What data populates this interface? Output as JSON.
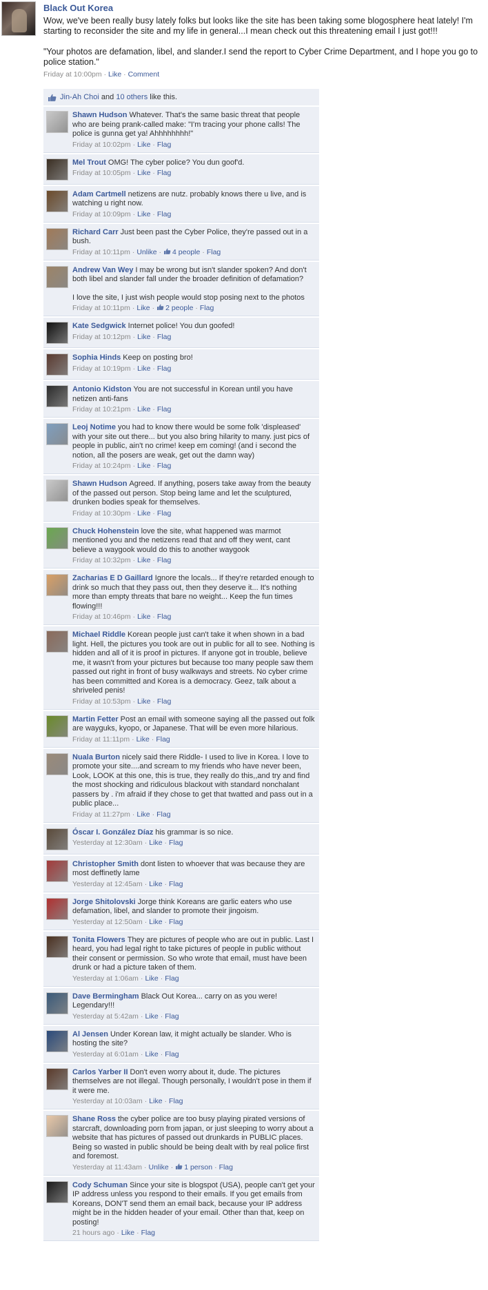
{
  "post": {
    "author": "Black Out Korea",
    "paragraphs": [
      "Wow, we've been really busy lately folks but looks like the site has been taking some blogosphere heat lately! I'm starting to reconsider the site and my life in general...I mean check out this threatening email I just got!!!",
      "\"Your photos are defamation, libel, and slander.I send the report to Cyber Crime Department, and I hope you go to police station.\""
    ],
    "timestamp": "Friday at 10:00pm",
    "like_label": "Like",
    "comment_label": "Comment"
  },
  "likes": {
    "first_liker": "Jin-Ah Choi",
    "joiner": "and",
    "others_link": "10 others",
    "suffix": "like this."
  },
  "comments": [
    {
      "name": "Shawn Hudson",
      "paragraphs": [
        "Whatever. That's the same basic threat that people who are being prank-called make: \"I'm tracing your phone calls! The police is gunna get ya! Ahhhhhhhh!\""
      ],
      "time": "Friday at 10:02pm",
      "actions": [
        "Like",
        "Flag"
      ],
      "avatar_color": "#c9c9c9"
    },
    {
      "name": "Mel Trout",
      "paragraphs": [
        "OMG! The cyber police? You dun goof'd."
      ],
      "time": "Friday at 10:05pm",
      "actions": [
        "Like",
        "Flag"
      ],
      "avatar_color": "#3a2e22"
    },
    {
      "name": "Adam Cartmell",
      "paragraphs": [
        "netizens are nutz. probably knows there u live, and is watching u right now."
      ],
      "time": "Friday at 10:09pm",
      "actions": [
        "Like",
        "Flag"
      ],
      "avatar_color": "#6b4a2a"
    },
    {
      "name": "Richard Carr",
      "paragraphs": [
        "Just been past the Cyber Police, they're passed out in a bush."
      ],
      "time": "Friday at 10:11pm",
      "actions": [
        "Unlike",
        "4 people",
        "Flag"
      ],
      "avatar_color": "#a07a58"
    },
    {
      "name": "Andrew Van Wey",
      "paragraphs": [
        "I may be wrong but isn't slander spoken? And don't both libel and slander fall under the broader definition of defamation?",
        "I love the site, I just wish people would stop posing next to the photos"
      ],
      "time": "Friday at 10:11pm",
      "actions": [
        "Like",
        "2 people",
        "Flag"
      ],
      "avatar_color": "#9c8468"
    },
    {
      "name": "Kate Sedgwick",
      "paragraphs": [
        "Internet police! You dun goofed!"
      ],
      "time": "Friday at 10:12pm",
      "actions": [
        "Like",
        "Flag"
      ],
      "avatar_color": "#111111"
    },
    {
      "name": "Sophia Hinds",
      "paragraphs": [
        "Keep on posting bro!"
      ],
      "time": "Friday at 10:19pm",
      "actions": [
        "Like",
        "Flag"
      ],
      "avatar_color": "#5a3a30"
    },
    {
      "name": "Antonio Kidston",
      "paragraphs": [
        "You are not successful in Korean until you have netizen anti-fans"
      ],
      "time": "Friday at 10:21pm",
      "actions": [
        "Like",
        "Flag"
      ],
      "avatar_color": "#2b2b2b"
    },
    {
      "name": "Leoj Notime",
      "paragraphs": [
        "you had to know there would be some folk 'displeased' with your site out there... but you also bring hilarity to many. just pics of people in public, ain't no crime! keep em coming! (and i second the notion, all the posers are weak, get out the damn way)"
      ],
      "time": "Friday at 10:24pm",
      "actions": [
        "Like",
        "Flag"
      ],
      "avatar_color": "#7f9fbf"
    },
    {
      "name": "Shawn Hudson",
      "paragraphs": [
        "Agreed. If anything, posers take away from the beauty of the passed out person. Stop being lame and let the sculptured, drunken bodies speak for themselves."
      ],
      "time": "Friday at 10:30pm",
      "actions": [
        "Like",
        "Flag"
      ],
      "avatar_color": "#c9c9c9"
    },
    {
      "name": "Chuck Hohenstein",
      "paragraphs": [
        "love the site, what happened was marmot mentioned you and the netizens read that and off they went, cant believe a waygook would do this to another waygook"
      ],
      "time": "Friday at 10:32pm",
      "actions": [
        "Like",
        "Flag"
      ],
      "avatar_color": "#6aa84f"
    },
    {
      "name": "Zacharias E D Gaillard",
      "paragraphs": [
        "Ignore the locals... If they're retarded enough to drink so much that they pass out, then they deserve it... It's nothing more than empty threats that bare no weight... Keep the fun times flowing!!!"
      ],
      "time": "Friday at 10:46pm",
      "actions": [
        "Like",
        "Flag"
      ],
      "avatar_color": "#d9a066"
    },
    {
      "name": "Michael Riddle",
      "paragraphs": [
        "Korean people just can't take it when shown in a bad light. Hell, the pictures you took are out in public for all to see. Nothing is hidden and all of it is proof in pictures. If anyone got in trouble, believe me, it wasn't from your pictures but because too many people saw them passed out right in front of busy walkways and streets. No cyber crime has been committed and Korea is a democracy. Geez, talk about a shriveled penis!"
      ],
      "time": "Friday at 10:53pm",
      "actions": [
        "Like",
        "Flag"
      ],
      "avatar_color": "#8a6a5a"
    },
    {
      "name": "Martin Fetter",
      "paragraphs": [
        "Post an email with someone saying all the passed out folk are wayguks, kyopo, or Japanese. That will be even more hilarious."
      ],
      "time": "Friday at 11:11pm",
      "actions": [
        "Like",
        "Flag"
      ],
      "avatar_color": "#6a8a2a"
    },
    {
      "name": "Nuala Burton",
      "paragraphs": [
        "nicely said there Riddle- I used to live in Korea. I love to promote your site....and scream to my friends who have never been, Look, LOOK at this one, this is true, they really do this,,and try and find the most shocking and ridiculous blackout with standard nonchalant passers by . i'm afraid if they chose to get that twatted and pass out in a public place..."
      ],
      "time": "Friday at 11:27pm",
      "actions": [
        "Like",
        "Flag"
      ],
      "avatar_color": "#9a8a7a"
    },
    {
      "name": "Óscar I. González Díaz",
      "paragraphs": [
        "his grammar is so nice."
      ],
      "time": "Yesterday at 12:30am",
      "actions": [
        "Like",
        "Flag"
      ],
      "avatar_color": "#5a4a3a"
    },
    {
      "name": "Christopher Smith",
      "paragraphs": [
        "dont listen to whoever that was because they are most deffinetly lame"
      ],
      "time": "Yesterday at 12:45am",
      "actions": [
        "Like",
        "Flag"
      ],
      "avatar_color": "#a33a3a"
    },
    {
      "name": "Jorge Shitolovski",
      "paragraphs": [
        "Jorge think Koreans are garlic eaters who use defamation, libel, and slander to promote their jingoism."
      ],
      "time": "Yesterday at 12:50am",
      "actions": [
        "Like",
        "Flag"
      ],
      "avatar_color": "#b03030"
    },
    {
      "name": "Tonita Flowers",
      "paragraphs": [
        "They are pictures of people who are out in public. Last I heard, you had legal right to take pictures of people in public without their consent or permission. So who wrote that email, must have been drunk or had a picture taken of them."
      ],
      "time": "Yesterday at 1:06am",
      "actions": [
        "Like",
        "Flag"
      ],
      "avatar_color": "#4a3020"
    },
    {
      "name": "Dave Bermingham",
      "paragraphs": [
        "Black Out Korea... carry on as you were! Legendary!!!"
      ],
      "time": "Yesterday at 5:42am",
      "actions": [
        "Like",
        "Flag"
      ],
      "avatar_color": "#3a5a7a"
    },
    {
      "name": "Al Jensen",
      "paragraphs": [
        "Under Korean law, it might actually be slander. Who is hosting the site?"
      ],
      "time": "Yesterday at 6:01am",
      "actions": [
        "Like",
        "Flag"
      ],
      "avatar_color": "#2a4a7a"
    },
    {
      "name": "Carlos Yarber II",
      "paragraphs": [
        "Don't even worry about it, dude. The pictures themselves are not illegal. Though personally, I wouldn't pose in them if it were me."
      ],
      "time": "Yesterday at 10:03am",
      "actions": [
        "Like",
        "Flag"
      ],
      "avatar_color": "#5a3a2a"
    },
    {
      "name": "Shane Ross",
      "paragraphs": [
        "the cyber police are too busy playing pirated versions of starcraft, downloading porn from japan, or just sleeping to worry about a website that has pictures of passed out drunkards in PUBLIC places. Being so wasted in public should be being dealt with by real police first and foremost."
      ],
      "time": "Yesterday at 11:43am",
      "actions": [
        "Unlike",
        "1 person",
        "Flag"
      ],
      "avatar_color": "#e8c8a8"
    },
    {
      "name": "Cody Schuman",
      "paragraphs": [
        "Since your site is blogspot (USA), people can't get your IP address unless you respond to their emails. If you get emails from Koreans, DON'T send them an email back, because your IP address might be in the hidden header of your email. Other than that, keep on posting!"
      ],
      "time": "21 hours ago",
      "actions": [
        "Like",
        "Flag"
      ],
      "avatar_color": "#1a1a1a"
    }
  ]
}
